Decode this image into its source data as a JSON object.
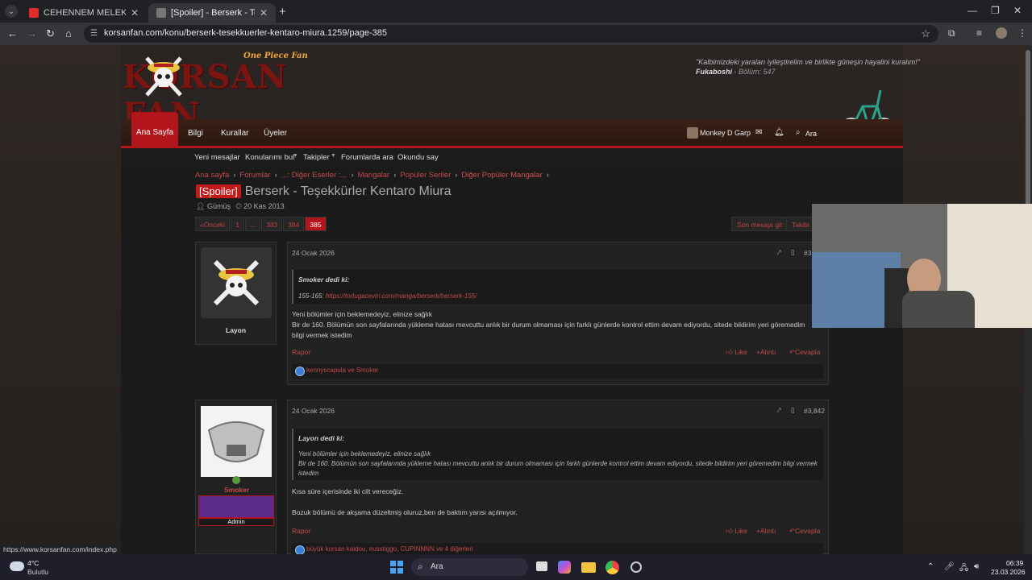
{
  "browser": {
    "tabs": [
      {
        "title": "CEHENNEM MELEKLERİ - TANRI...",
        "favicon_color": "#e02d2d"
      },
      {
        "title": "[Spoiler] - Berserk - Teşekkürler...",
        "favicon_color": "#888888"
      }
    ],
    "new_tab": "+",
    "url": "korsanfan.com/konu/berserk-tesekkuerler-kentaro-miura.1259/page-385"
  },
  "site": {
    "tagline": "One Piece Fan",
    "logo_text": "KORSAN FAN",
    "quote": "\"Kalbimizdeki yaraları iyileştirelim ve birlikte güneşin hayalini kuralım!\"",
    "quote_author": "Fukaboshi",
    "quote_source": " - Bölüm: 547"
  },
  "nav": {
    "home": "Ana Sayfa",
    "items": [
      "Bilgi",
      "Kurallar",
      "Üyeler"
    ],
    "user": "Monkey D Garp",
    "search": "Ara"
  },
  "subnav": [
    "Yeni mesajlar",
    "Konularımı bul",
    "Takipler",
    "Forumlarda ara",
    "Okundu say"
  ],
  "breadcrumb": [
    "Ana sayfa",
    "Forumlar",
    "...: Diğer Eserler :...",
    "Mangalar",
    "Popüler Seriler",
    "Diğer Popüler Mangalar"
  ],
  "thread": {
    "tag": "[Spoiler]",
    "title": "Berserk - Teşekkürler Kentaro Miura",
    "author": "Gümüş",
    "date": "20 Kas 2013"
  },
  "pagination": {
    "prev": "«Önceki",
    "pages": [
      "1",
      "...",
      "383",
      "384",
      "385"
    ],
    "active": "385",
    "last_post": "Son mesaja git",
    "follow": "Takibi bırak"
  },
  "posts": [
    {
      "username": "Layon",
      "date": "24 Ocak 2026",
      "number": "#3,",
      "quote_author": "Smoker dedi ki:",
      "quote_prefix": "155-165: ",
      "quote_link": "https://tortugaceviri.com/manga/berserk/berserk-155/",
      "text1": "Yeni bölümler için beklemedeyiz, elinize sağlık",
      "text2": "Bir de 160. Bölümün son sayfalarında yükleme hatası mevcuttu anlık bir durum olmaması için farklı günlerde kontrol ettim devam ediyordu, sitede bildirim yeri göremedim",
      "text3": "bilgi vermek istedim",
      "report": "Rapor",
      "like": "Like",
      "quote_btn": "Alıntı",
      "reply": "Cevapla",
      "reactions": "kennyscapula ve Smoker"
    },
    {
      "username": "Smoker",
      "role": "Admin",
      "date": "24 Ocak 2026",
      "number": "#3,842",
      "quote_author": "Layon dedi ki:",
      "quote_line1": "Yeni bölümler için beklemedeyiz, elinize sağlık",
      "quote_line2": "Bir de 160. Bölümün son sayfalarında yükleme hatası mevcuttu anlık bir durum olmaması için farklı günlerde kontrol ettim devam ediyordu, sitede bildirim yeri göremedim bilgi vermek",
      "quote_line3": "istedim",
      "text1": "Kısa süre içerisinde iki cilt vereceğiz.",
      "text2": "Bozuk bölümü de akşama düzeltmiş oluruz,ben de baktım yarısı açılmıyor.",
      "report": "Rapor",
      "like": "Like",
      "quote_btn": "Alıntı",
      "reply": "Cevapla",
      "reactions": "büyük korsan kaidou, eusstiggo, CUPINNNN ve 4 diğerleri"
    }
  ],
  "status_url": "https://www.korsanfan.com/index.php",
  "taskbar": {
    "temp": "4°C",
    "weather": "Bulutlu",
    "search": "Ara",
    "time": "06:39",
    "date": "23.03.2026"
  },
  "colors": {
    "accent": "#b2161c",
    "link": "#c24a4a",
    "bg": "#1b1b1b"
  }
}
